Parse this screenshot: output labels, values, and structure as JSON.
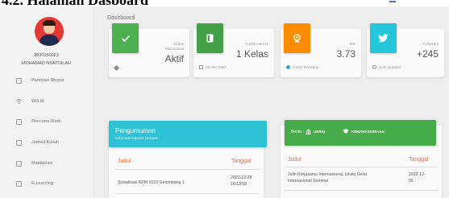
{
  "doc": {
    "heading": "4.2.  Halaman Dasboard"
  },
  "sidebar": {
    "nim": "2020150023",
    "username": "MOHAMAD NSATOILAH",
    "items": [
      {
        "label": "Panduan Shopie",
        "icon": "document-icon"
      },
      {
        "label": "Wifi Id",
        "icon": "wifi-icon"
      },
      {
        "label": "Rencana Studi",
        "icon": "book-icon"
      },
      {
        "label": "Jadwal Kuliah",
        "icon": "calendar-icon"
      },
      {
        "label": "Matrikulasi",
        "icon": "grid-icon"
      },
      {
        "label": "E-Learning",
        "icon": "laptop-icon"
      }
    ]
  },
  "main": {
    "breadcrumb": "Dashboard"
  },
  "cards": [
    {
      "label": "Status",
      "label2": "Mahasiswa",
      "value": "Aktif",
      "footer": "",
      "color": "#4caf50",
      "icon": "check-icon",
      "footer_icon": "tag-icon"
    },
    {
      "label": "Kuliah Hari Ini",
      "value": "1 Kelas",
      "footer": "28 Dec 2022",
      "color": "#43a047",
      "icon": "book-icon",
      "footer_icon": "calendar-icon"
    },
    {
      "label": "IPK",
      "value": "3.73",
      "footer": "Cetak Transkrip",
      "color": "#fb8c00",
      "icon": "badge-icon",
      "footer_icon": "dot-icon"
    },
    {
      "label": "Followers",
      "value": "+245",
      "footer": "Just Updated",
      "color": "#26c6da",
      "icon": "twitter-icon",
      "footer_icon": "clock-icon"
    }
  ],
  "pengumuman": {
    "title": "Pengumuman",
    "subtitle": "Informasi seputar kampus",
    "col_judul": "Judul",
    "col_tanggal": "Tanggal",
    "rows": [
      {
        "judul": "Sosialisasi KPM 2023 Gelombang 1",
        "tanggal_line1": "2022-12-28",
        "tanggal_line2": "16:13:58"
      }
    ]
  },
  "berita": {
    "label": "Berita :",
    "tab1": "UNSIQ",
    "tab2": "KEMAHASISWAAN",
    "col_judul": "Judul",
    "col_tanggal": "Tanggal",
    "rows": [
      {
        "judul_line1": "Jalin Kerjasama Internasional, Unsiq Gelar",
        "judul_line2": "Internasional Seminar",
        "tanggal_line1": "2022-12-",
        "tanggal_line2": "05"
      }
    ]
  },
  "colors": {
    "pengumuman_header": "#2fc1d4",
    "berita_header": "#46ab4a",
    "accent_text": "#f06a35"
  }
}
